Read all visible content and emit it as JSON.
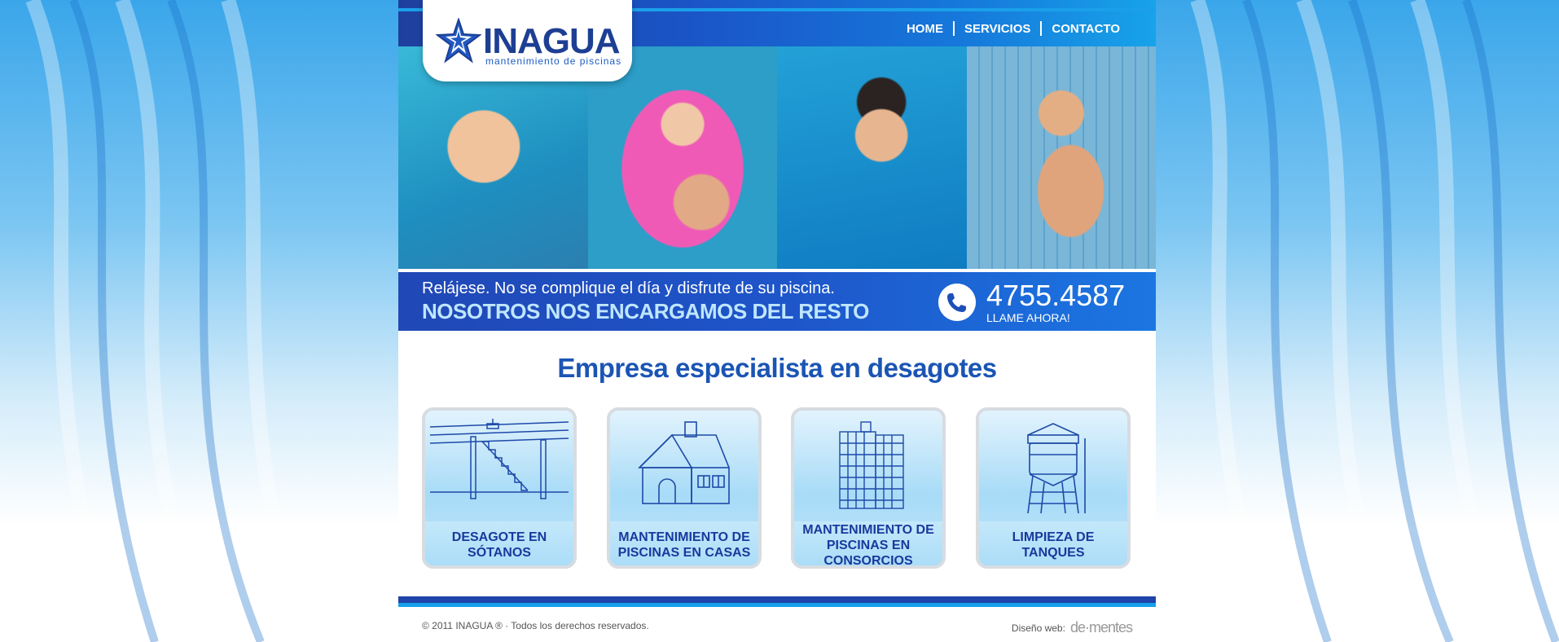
{
  "brand": {
    "name": "INAGUA",
    "tagline": "mantenimiento de piscinas"
  },
  "nav": {
    "items": [
      {
        "label": "HOME"
      },
      {
        "label": "SERVICIOS"
      },
      {
        "label": "CONTACTO"
      }
    ]
  },
  "banner": {
    "line1": "Relájese. No se complique el día y disfrute de su piscina.",
    "line2": "NOSOTROS NOS ENCARGAMOS DEL RESTO",
    "phone": "4755.4587",
    "phone_cta": "LLAME AHORA!"
  },
  "main": {
    "heading": "Empresa especialista en desagotes",
    "services": [
      {
        "label": "DESAGOTE EN\nSÓTANOS",
        "icon": "basement-stairs-icon"
      },
      {
        "label": "MANTENIMIENTO DE\nPISCINAS EN CASAS",
        "icon": "house-icon"
      },
      {
        "label": "MANTENIMIENTO DE\nPISCINAS EN CONSORCIOS",
        "icon": "building-icon"
      },
      {
        "label": "LIMPIEZA DE\nTANQUES",
        "icon": "water-tank-icon"
      }
    ]
  },
  "footer": {
    "copyright": "© 2011 INAGUA ® · Todos los derechos reservados.",
    "design_label": "Diseño web:",
    "design_brand": "de·mentes"
  },
  "colors": {
    "primary": "#1d3f93",
    "accent": "#1b76e2",
    "heading": "#1b55b4"
  }
}
